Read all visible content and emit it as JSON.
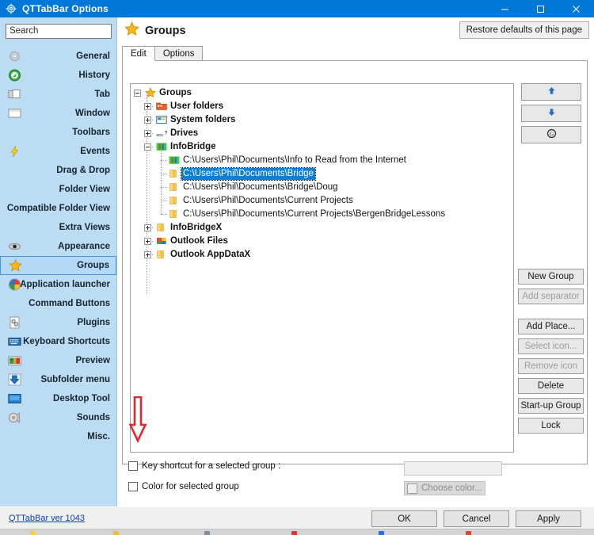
{
  "window": {
    "title": "QTTabBar Options",
    "icon": "gear-icon",
    "buttons": {
      "minimize": "minimize-icon",
      "maximize": "maximize-icon",
      "close": "close-icon"
    }
  },
  "sidebar": {
    "search": {
      "value": "Search",
      "placeholder": "Search"
    },
    "items": [
      {
        "label": "General",
        "icon": "gear-icon",
        "selected": false
      },
      {
        "label": "History",
        "icon": "history-compass-icon",
        "selected": false
      },
      {
        "label": "Tab",
        "icon": "tab-icon",
        "selected": false
      },
      {
        "label": "Window",
        "icon": "window-icon",
        "selected": false
      },
      {
        "label": "Toolbars",
        "icon": "",
        "selected": false
      },
      {
        "label": "Events",
        "icon": "lightning-icon",
        "selected": false
      },
      {
        "label": "Drag & Drop",
        "icon": "",
        "selected": false
      },
      {
        "label": "Folder View",
        "icon": "",
        "selected": false
      },
      {
        "label": "Compatible Folder View",
        "icon": "",
        "selected": false
      },
      {
        "label": "Extra Views",
        "icon": "",
        "selected": false
      },
      {
        "label": "Appearance",
        "icon": "eye-icon",
        "selected": false
      },
      {
        "label": "Groups",
        "icon": "star-icon",
        "selected": true
      },
      {
        "label": "Application launcher",
        "icon": "launcher-icon",
        "selected": false
      },
      {
        "label": "Command Buttons",
        "icon": "",
        "selected": false
      },
      {
        "label": "Plugins",
        "icon": "plugins-icon",
        "selected": false
      },
      {
        "label": "Keyboard Shortcuts",
        "icon": "keyboard-icon",
        "selected": false
      },
      {
        "label": "Preview",
        "icon": "preview-icon",
        "selected": false
      },
      {
        "label": "Subfolder menu",
        "icon": "down-arrow-icon",
        "selected": false
      },
      {
        "label": "Desktop Tool",
        "icon": "desktop-icon",
        "selected": false
      },
      {
        "label": "Sounds",
        "icon": "speaker-icon",
        "selected": false
      },
      {
        "label": "Misc.",
        "icon": "",
        "selected": false
      }
    ]
  },
  "page": {
    "title": "Groups",
    "title_icon": "star-icon",
    "help_label": "?",
    "restore_defaults_label": "Restore defaults of this page"
  },
  "tabs": [
    {
      "label": "Edit",
      "active": true
    },
    {
      "label": "Options",
      "active": false
    }
  ],
  "tree": {
    "nodes": [
      {
        "label": "Groups",
        "depth": 0,
        "icon": "star-icon",
        "expander": "minus",
        "selected": false,
        "bold": true
      },
      {
        "label": "User folders",
        "depth": 1,
        "icon": "folder-red-icon",
        "expander": "plus",
        "selected": false,
        "bold": true
      },
      {
        "label": "System folders",
        "depth": 1,
        "icon": "system-icon",
        "expander": "plus",
        "selected": false,
        "bold": true
      },
      {
        "label": "Drives",
        "depth": 1,
        "icon": "drive-icon",
        "expander": "plus",
        "selected": false,
        "bold": true
      },
      {
        "label": "InfoBridge",
        "depth": 1,
        "icon": "green-app-icon",
        "expander": "minus",
        "selected": false,
        "bold": true
      },
      {
        "label": "C:\\Users\\Phil\\Documents\\Info to Read from the Internet",
        "depth": 2,
        "icon": "green-app-icon",
        "expander": "none",
        "selected": false,
        "bold": false
      },
      {
        "label": "C:\\Users\\Phil\\Documents\\Bridge",
        "depth": 2,
        "icon": "folder-icon",
        "expander": "none",
        "selected": true,
        "bold": false
      },
      {
        "label": "C:\\Users\\Phil\\Documents\\Bridge\\Doug",
        "depth": 2,
        "icon": "folder-icon",
        "expander": "none",
        "selected": false,
        "bold": false
      },
      {
        "label": "C:\\Users\\Phil\\Documents\\Current Projects",
        "depth": 2,
        "icon": "folder-icon",
        "expander": "none",
        "selected": false,
        "bold": false
      },
      {
        "label": "C:\\Users\\Phil\\Documents\\Current Projects\\BergenBridgeLessons",
        "depth": 2,
        "icon": "folder-icon",
        "expander": "none",
        "selected": false,
        "bold": false
      },
      {
        "label": "InfoBridgeX",
        "depth": 1,
        "icon": "folder-icon",
        "expander": "plus",
        "selected": false,
        "bold": true
      },
      {
        "label": "Outlook Files",
        "depth": 1,
        "icon": "outlook-icon",
        "expander": "plus",
        "selected": false,
        "bold": true
      },
      {
        "label": "Outlook AppDataX",
        "depth": 1,
        "icon": "folder-icon",
        "expander": "plus",
        "selected": false,
        "bold": true
      }
    ]
  },
  "move_buttons": [
    {
      "label": "↑",
      "name": "move-up-button",
      "icon": "up-arrow-icon",
      "disabled": false
    },
    {
      "label": "↓",
      "name": "move-down-button",
      "icon": "down-arrow-icon",
      "disabled": false
    },
    {
      "label": "Ⓖ",
      "name": "go-button",
      "icon": "g-circle-icon",
      "disabled": false
    }
  ],
  "action_buttons": [
    {
      "label": "New Group",
      "disabled": false
    },
    {
      "label": "Add separator",
      "disabled": true
    },
    {
      "label": "Add Place...",
      "disabled": false
    },
    {
      "label": "Select icon...",
      "disabled": true
    },
    {
      "label": "Remove icon",
      "disabled": true
    },
    {
      "label": "Delete",
      "disabled": false
    },
    {
      "label": "Start-up Group",
      "disabled": false
    },
    {
      "label": "Lock",
      "disabled": false
    }
  ],
  "options": {
    "key_shortcut": {
      "label": "Key shortcut for a selected group :",
      "checked": false,
      "field_value": ""
    },
    "color_group": {
      "label": "Color for selected group",
      "checked": false,
      "button_label": "Choose color...",
      "button_disabled": true
    }
  },
  "footer": {
    "version_link": "QTTabBar ver 1043",
    "ok": "OK",
    "cancel": "Cancel",
    "apply": "Apply"
  },
  "annotation": {
    "type": "red-down-arrow",
    "color": "#e8232a"
  },
  "colors": {
    "accent": "#0078d7",
    "sidebar": "#bcdcf4",
    "selection": "#0f7fd4",
    "annotation_red": "#e8232a"
  }
}
